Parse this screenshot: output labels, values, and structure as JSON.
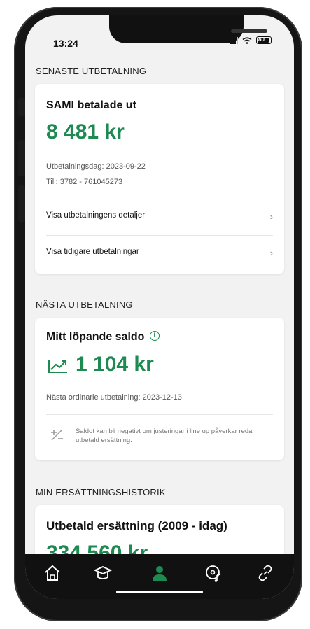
{
  "status": {
    "time": "13:24",
    "battery": "80"
  },
  "last_payment": {
    "section_title": "SENASTE UTBETALNING",
    "heading": "SAMI betalade ut",
    "amount": "8 481 kr",
    "date_line": "Utbetalningsdag: 2023-09-22",
    "account_line": "Till: 3782 - 761045273",
    "link_details": "Visa utbetalningens detaljer",
    "link_previous": "Visa tidigare utbetalningar"
  },
  "next_payment": {
    "section_title": "NÄSTA UTBETALNING",
    "heading": "Mitt löpande saldo",
    "amount": "1 104 kr",
    "next_date_line": "Nästa ordinarie utbetalning: 2023-12-13",
    "note": "Saldot kan bli negativt om justeringar i line up påverkar redan utbetald ersättning."
  },
  "history": {
    "section_title": "MIN ERSÄTTNINGSHISTORIK",
    "heading": "Utbetald ersättning (2009 - idag)",
    "amount": "334 560 kr"
  },
  "nav": {
    "items": [
      "home-icon",
      "graduation-cap-icon",
      "person-icon",
      "music-disc-icon",
      "link-icon"
    ],
    "active": "person-icon"
  },
  "colors": {
    "accent": "#1d8a52",
    "background": "#f2f2f2",
    "nav": "#111111"
  }
}
